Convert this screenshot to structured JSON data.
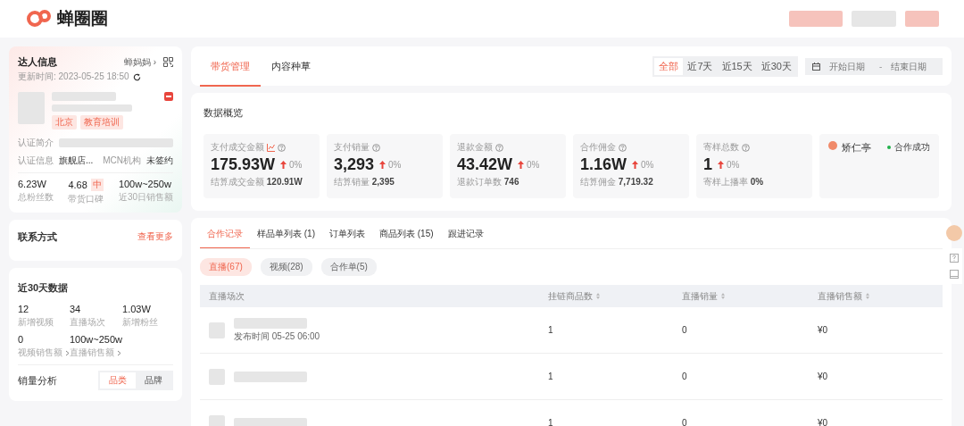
{
  "header": {
    "logo_text": "蝉圈圈"
  },
  "profile": {
    "title": "达人信息",
    "source_link": "蝉妈妈 ›",
    "updated": "更新时间: 2023-05-25 18:50",
    "tags": [
      "北京",
      "教育培训"
    ],
    "auth_intro_label": "认证简介",
    "auth_info_label": "认证信息",
    "auth_info_value": "旗舰店...",
    "mcn_label": "MCN机构",
    "mcn_value": "未签约",
    "stats": [
      {
        "value": "6.23W",
        "label": "总粉丝数"
      },
      {
        "value": "4.68",
        "badge": "中",
        "label": "带货口碑"
      },
      {
        "value": "100w~250w",
        "label": "近30日销售额"
      }
    ]
  },
  "contact": {
    "title": "联系方式",
    "link": "查看更多"
  },
  "recent": {
    "title": "近30天数据",
    "stats": [
      {
        "value": "12",
        "label": "新增视频",
        "link": false
      },
      {
        "value": "34",
        "label": "直播场次",
        "link": false
      },
      {
        "value": "1.03W",
        "label": "新增粉丝",
        "link": false
      },
      {
        "value": "0",
        "label": "视频销售额",
        "link": true
      },
      {
        "value": "100w~250w",
        "label": "直播销售额",
        "link": true
      }
    ],
    "sales_title": "销量分析",
    "toggle": [
      {
        "label": "品类",
        "selected": true
      },
      {
        "label": "品牌",
        "selected": false
      }
    ]
  },
  "main_tabs": [
    {
      "label": "带货管理",
      "selected": true
    },
    {
      "label": "内容种草",
      "selected": false
    }
  ],
  "ranges": [
    {
      "label": "全部",
      "selected": true
    },
    {
      "label": "近7天",
      "selected": false
    },
    {
      "label": "近15天",
      "selected": false
    },
    {
      "label": "近30天",
      "selected": false
    }
  ],
  "date_range": {
    "start_placeholder": "开始日期",
    "separator": "-",
    "end_placeholder": "结束日期"
  },
  "overview": {
    "title": "数据概览",
    "metrics": [
      {
        "label": "支付成交金额",
        "chart_icon": true,
        "value": "175.93W",
        "change": "0%",
        "sub_label": "结算成交金额",
        "sub_value": "120.91W"
      },
      {
        "label": "支付销量",
        "chart_icon": false,
        "value": "3,293",
        "change": "0%",
        "sub_label": "结算销量",
        "sub_value": "2,395"
      },
      {
        "label": "退款金额",
        "chart_icon": false,
        "value": "43.42W",
        "change": "0%",
        "sub_label": "退款订单数",
        "sub_value": "746"
      },
      {
        "label": "合作佣金",
        "chart_icon": false,
        "value": "1.16W",
        "change": "0%",
        "sub_label": "结算佣金",
        "sub_value": "7,719.32"
      },
      {
        "label": "寄样总数",
        "chart_icon": false,
        "value": "1",
        "change": "0%",
        "sub_label": "寄样上播率",
        "sub_value": "0%"
      }
    ],
    "partner": {
      "name": "矫仁亭",
      "status": "合作成功",
      "color": "#22b14c"
    }
  },
  "records": {
    "tabs": [
      {
        "label": "合作记录",
        "selected": true
      },
      {
        "label": "样品单列表 (1)",
        "selected": false
      },
      {
        "label": "订单列表",
        "selected": false
      },
      {
        "label": "商品列表 (15)",
        "selected": false
      },
      {
        "label": "跟进记录",
        "selected": false
      }
    ],
    "chips": [
      {
        "label": "直播(67)",
        "selected": true
      },
      {
        "label": "视频(28)",
        "selected": false
      },
      {
        "label": "合作单(5)",
        "selected": false
      }
    ],
    "columns": [
      {
        "label": "直播场次",
        "sortable": false
      },
      {
        "label": "挂链商品数",
        "sortable": true
      },
      {
        "label": "直播销量",
        "sortable": true
      },
      {
        "label": "直播销售额",
        "sortable": true
      }
    ],
    "rows": [
      {
        "time": "发布时间 05-25 06:00",
        "links": "1",
        "sales": "0",
        "amount": "¥0"
      },
      {
        "links": "1",
        "sales": "0",
        "amount": "¥0"
      },
      {
        "links": "1",
        "sales": "0",
        "amount": "¥0"
      }
    ]
  }
}
